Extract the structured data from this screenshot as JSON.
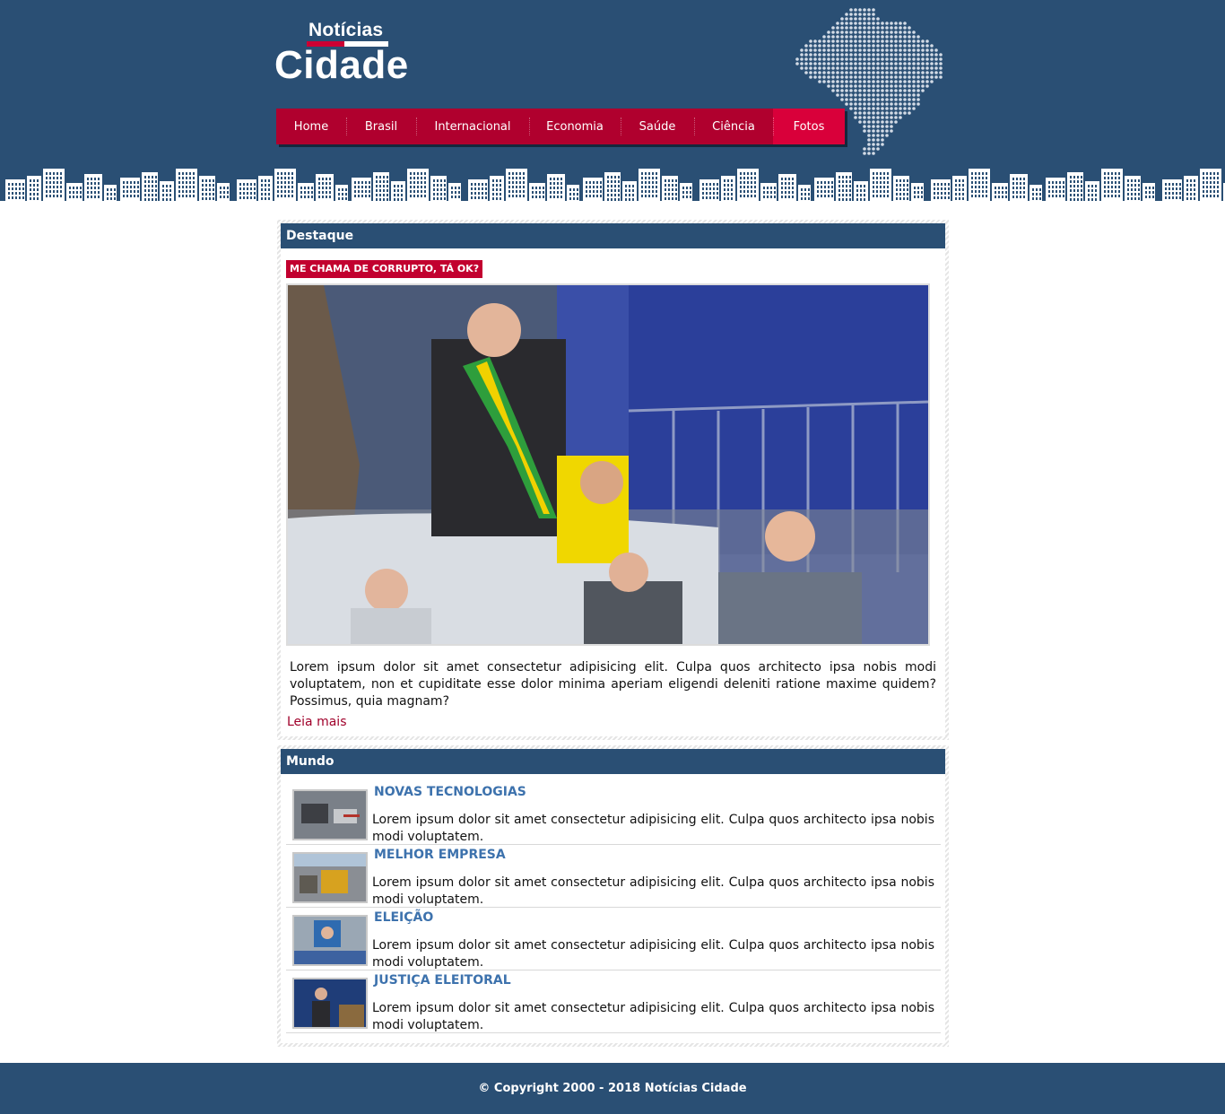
{
  "brand": {
    "top": "Notícias",
    "main": "Cidade"
  },
  "nav": [
    {
      "label": "Home",
      "w": 78
    },
    {
      "label": "Brasil",
      "w": 78
    },
    {
      "label": "Internacional",
      "w": 126
    },
    {
      "label": "Economia",
      "w": 102
    },
    {
      "label": "Saúde",
      "w": 82
    },
    {
      "label": "Ciência",
      "w": 88
    },
    {
      "label": "Fotos",
      "w": 80
    }
  ],
  "active_nav": "Fotos",
  "destaque": {
    "title": "Destaque",
    "tag": "ME CHAMA DE CORRUPTO, TÁ OK?",
    "text": "Lorem ipsum dolor sit amet consectetur adipisicing elit. Culpa quos architecto ipsa nobis modi voluptatem, non et cupiditate esse dolor minima aperiam eligendi deleniti ratione maxime quidem? Possimus, quia magnam?",
    "read_more": "Leia mais"
  },
  "mundo": {
    "title": "Mundo",
    "items": [
      {
        "title": "NOVAS TECNOLOGIAS",
        "text": "Lorem ipsum dolor sit amet consectetur adipisicing elit. Culpa quos architecto ipsa nobis modi voluptatem."
      },
      {
        "title": "MELHOR EMPRESA",
        "text": "Lorem ipsum dolor sit amet consectetur adipisicing elit. Culpa quos architecto ipsa nobis modi voluptatem."
      },
      {
        "title": "ELEIÇÃO",
        "text": "Lorem ipsum dolor sit amet consectetur adipisicing elit. Culpa quos architecto ipsa nobis modi voluptatem."
      },
      {
        "title": "JUSTIÇA ELEITORAL",
        "text": "Lorem ipsum dolor sit amet consectetur adipisicing elit. Culpa quos architecto ipsa nobis modi voluptatem."
      }
    ]
  },
  "footer": "© Copyright 2000 - 2018 Notícias Cidade",
  "colors": {
    "primary": "#2a4f74",
    "accent": "#b0002e",
    "link": "#3d72ad"
  }
}
